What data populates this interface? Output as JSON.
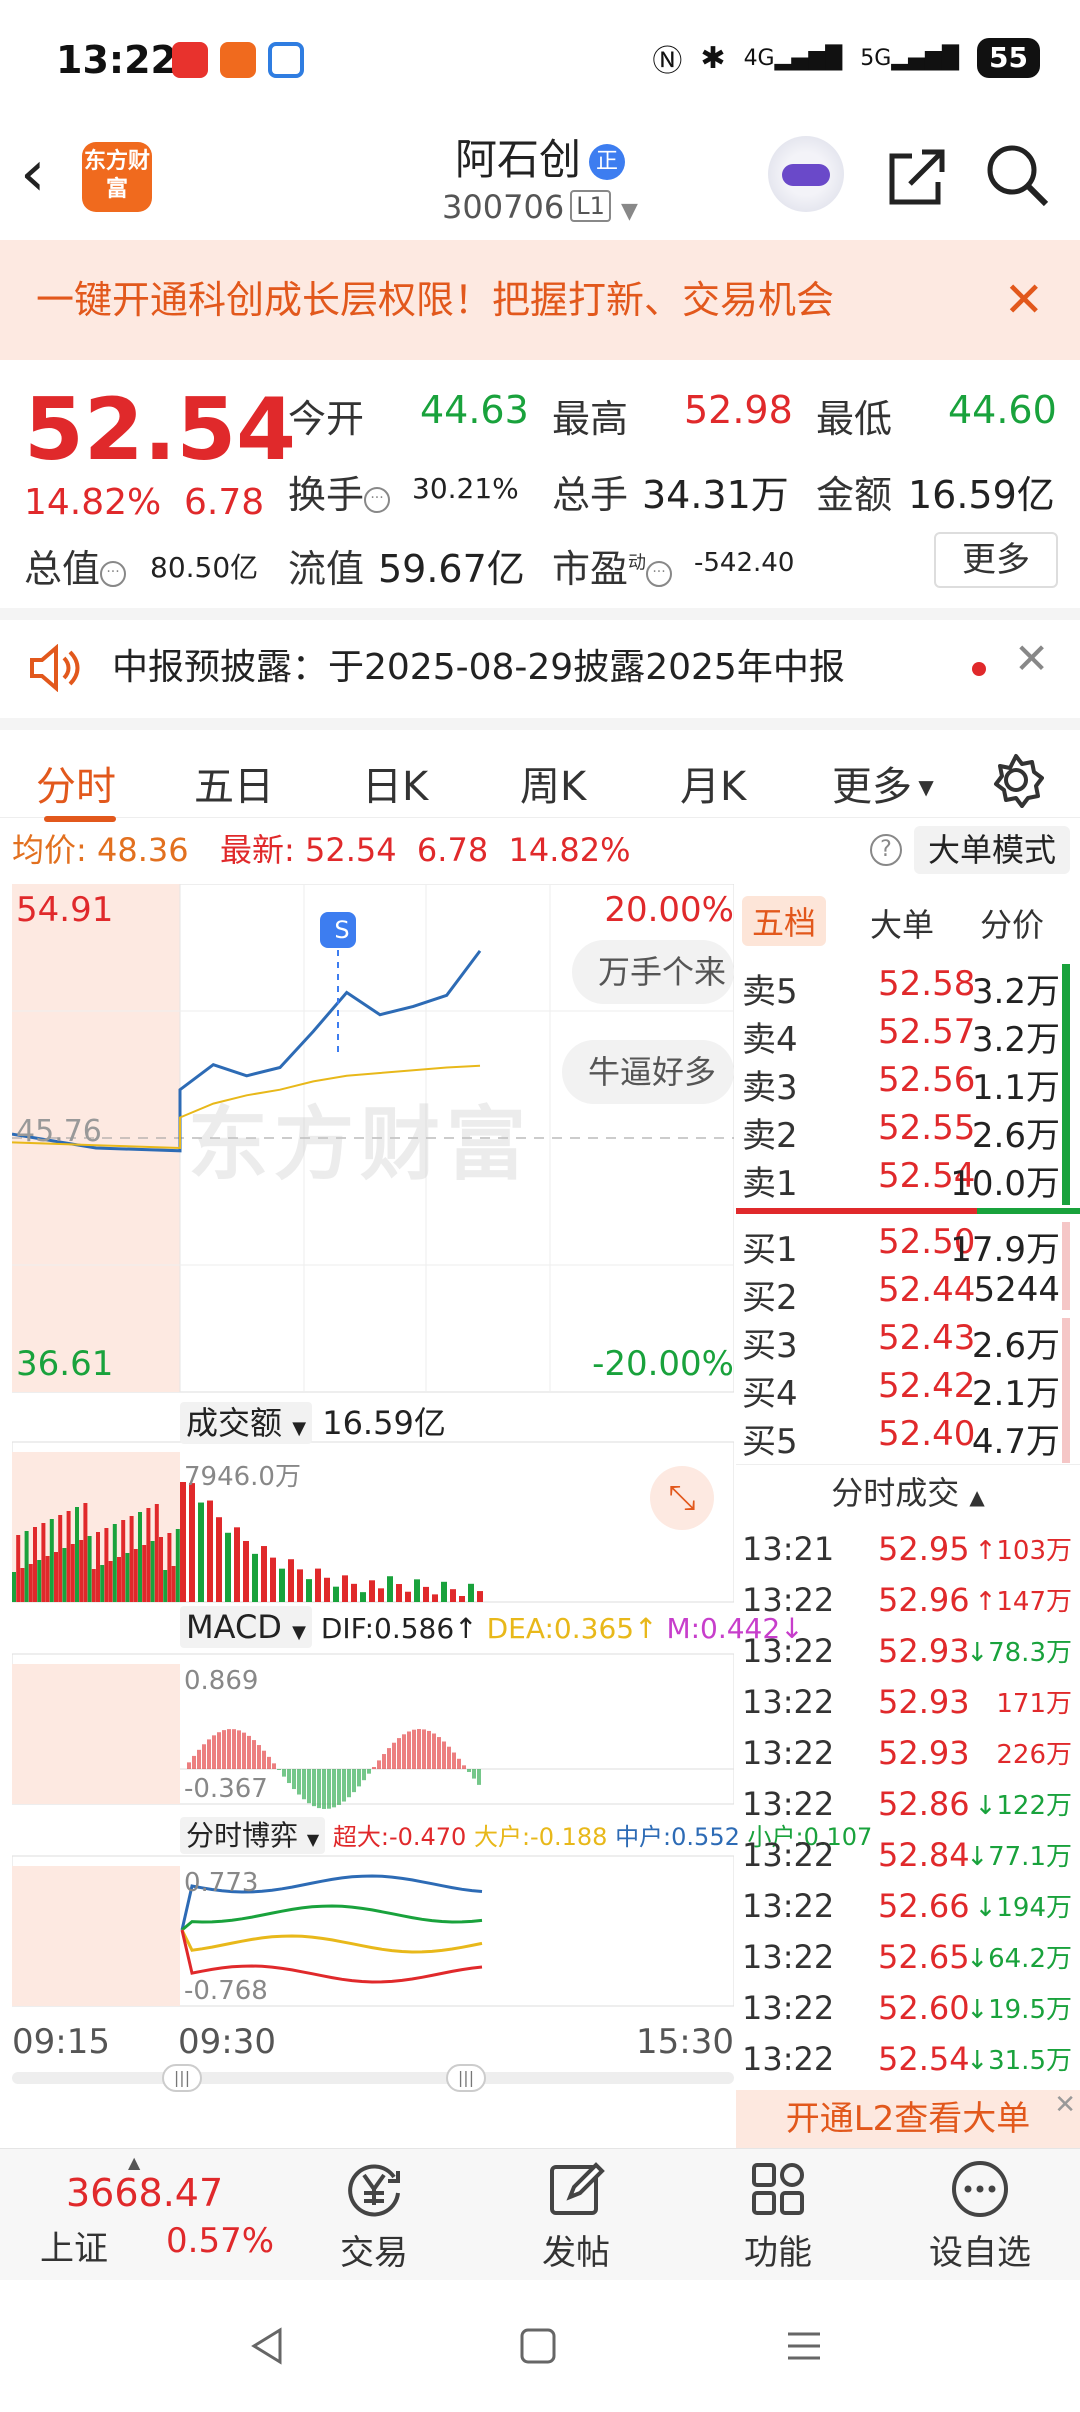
{
  "status_bar": {
    "time": "13:22",
    "battery": "55"
  },
  "header": {
    "logo_text": "东方财富",
    "stock_name": "阿石创",
    "badge": "正",
    "code": "300706",
    "level": "L1"
  },
  "banner": {
    "text": "一键开通科创成长层权限！把握打新、交易机会"
  },
  "quote": {
    "price": "52.54",
    "change_pct": "14.82%",
    "change": "6.78",
    "open_label": "今开",
    "open": "44.63",
    "high_label": "最高",
    "high": "52.98",
    "low_label": "最低",
    "low": "44.60",
    "turnover_label": "换手",
    "turnover": "30.21%",
    "volume_label": "总手",
    "volume": "34.31万",
    "amount_label": "金额",
    "amount": "16.59亿",
    "mktcap_label": "总值",
    "mktcap": "80.50亿",
    "float_label": "流值",
    "float": "59.67亿",
    "pe_label": "市盈",
    "pe_sup": "动",
    "pe": "-542.40",
    "more": "更多"
  },
  "notice": {
    "text": "中报预披露：于2025-08-29披露2025年中报"
  },
  "tabs": [
    "分时",
    "五日",
    "日K",
    "周K",
    "月K",
    "更多"
  ],
  "avg_bar": {
    "avg_label": "均价:",
    "avg": "48.36",
    "latest_label": "最新:",
    "latest": "52.54",
    "change": "6.78",
    "pct": "14.82%",
    "big_order": "大单模式"
  },
  "chart": {
    "y_max": "54.91",
    "y_mid": "45.76",
    "y_min": "36.61",
    "pct_max": "20.00%",
    "pct_min": "-20.00%",
    "watermark": "东方财富",
    "comment1": "万手个来",
    "comment2": "牛逼好多",
    "s_marker": "S",
    "volume_label": "成交额",
    "volume_total": "16.59亿",
    "volume_max": "7946.0万",
    "macd_label": "MACD",
    "dif": "DIF:0.586↑",
    "dea": "DEA:0.365↑",
    "m": "M:0.442↓",
    "macd_max": "0.869",
    "macd_min": "-0.367",
    "flow_label": "分时博弈",
    "super_large": "超大:-0.470",
    "large": "大户:-0.188",
    "medium": "中户:0.552",
    "small": "小户:0.107",
    "flow_max": "0.773",
    "flow_min": "-0.768",
    "time_start": "09:15",
    "time_open": "09:30",
    "time_end": "15:30"
  },
  "chart_data": {
    "type": "line",
    "series": [
      {
        "values": [
          45.9,
          45.4,
          45.3,
          47.5,
          48.4,
          48.0,
          48.3,
          49.6,
          51.0,
          50.2,
          50.5,
          50.9,
          52.5
        ]
      },
      {
        "values": [
          45.6,
          45.5,
          45.4,
          46.5,
          47.0,
          47.3,
          47.5,
          47.8,
          48.0,
          48.1,
          48.2,
          48.3,
          48.36
        ]
      }
    ],
    "ylim": [
      36.61,
      54.91
    ]
  },
  "orderbook": {
    "tabs": [
      "五档",
      "大单",
      "分价"
    ],
    "sells": [
      {
        "label": "卖5",
        "price": "52.58",
        "vol": "3.2万"
      },
      {
        "label": "卖4",
        "price": "52.57",
        "vol": "3.2万"
      },
      {
        "label": "卖3",
        "price": "52.56",
        "vol": "1.1万"
      },
      {
        "label": "卖2",
        "price": "52.55",
        "vol": "2.6万"
      },
      {
        "label": "卖1",
        "price": "52.54",
        "vol": "10.0万"
      }
    ],
    "buys": [
      {
        "label": "买1",
        "price": "52.50",
        "vol": "17.9万"
      },
      {
        "label": "买2",
        "price": "52.44",
        "vol": "5244"
      },
      {
        "label": "买3",
        "price": "52.43",
        "vol": "2.6万"
      },
      {
        "label": "买4",
        "price": "52.42",
        "vol": "2.1万"
      },
      {
        "label": "买5",
        "price": "52.40",
        "vol": "4.7万"
      }
    ],
    "ticks_title": "分时成交",
    "ticks": [
      {
        "time": "13:21",
        "price": "52.95",
        "vol": "↑103万",
        "dir": "up"
      },
      {
        "time": "13:22",
        "price": "52.96",
        "vol": "↑147万",
        "dir": "up"
      },
      {
        "time": "13:22",
        "price": "52.93",
        "vol": "↓78.3万",
        "dir": "down"
      },
      {
        "time": "13:22",
        "price": "52.93",
        "vol": "171万",
        "dir": "none"
      },
      {
        "time": "13:22",
        "price": "52.93",
        "vol": "226万",
        "dir": "none"
      },
      {
        "time": "13:22",
        "price": "52.86",
        "vol": "↓122万",
        "dir": "down"
      },
      {
        "time": "13:22",
        "price": "52.84",
        "vol": "↓77.1万",
        "dir": "down"
      },
      {
        "time": "13:22",
        "price": "52.66",
        "vol": "↓194万",
        "dir": "down"
      },
      {
        "time": "13:22",
        "price": "52.65",
        "vol": "↓64.2万",
        "dir": "down"
      },
      {
        "time": "13:22",
        "price": "52.60",
        "vol": "↓19.5万",
        "dir": "down"
      },
      {
        "time": "13:22",
        "price": "52.54",
        "vol": "↓31.5万",
        "dir": "down"
      }
    ],
    "l2_banner": "开通L2查看大单"
  },
  "bottom_nav": {
    "index_value": "3668.47",
    "index_name": "上证",
    "index_pct": "0.57%",
    "trade": "交易",
    "post": "发帖",
    "func": "功能",
    "watchlist": "设自选"
  }
}
